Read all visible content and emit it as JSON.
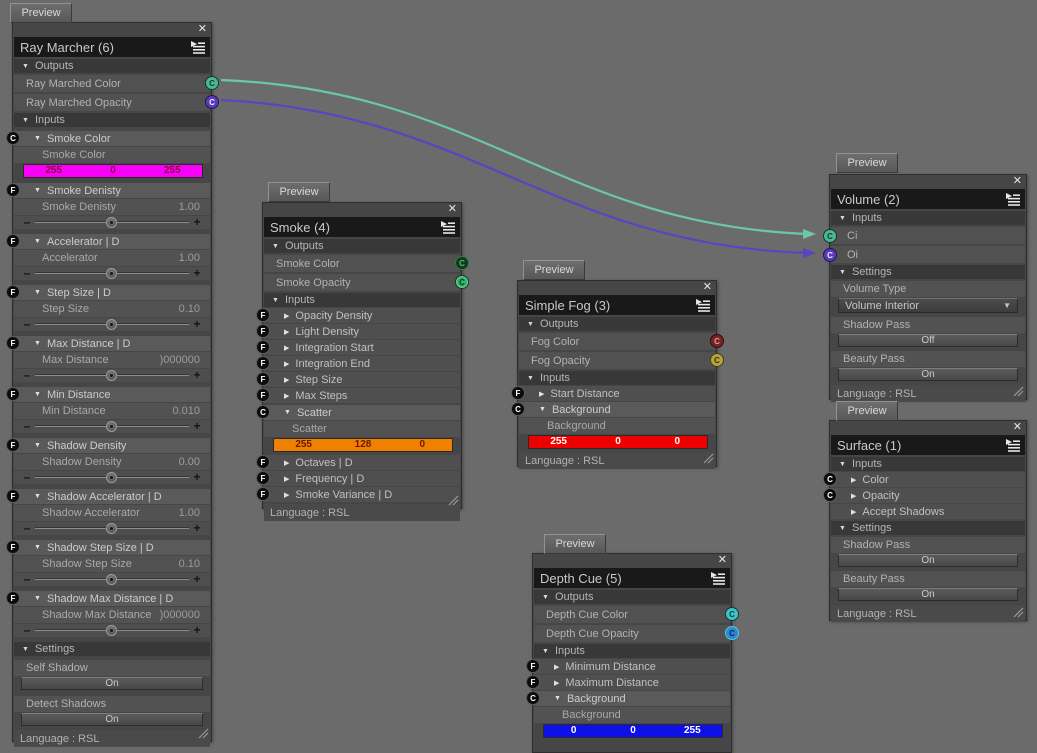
{
  "ui": {
    "preview_label": "Preview",
    "language_label": "Language : RSL"
  },
  "icons": {
    "close": "✕",
    "collapse": "▼",
    "expand": "▶",
    "minus": "–",
    "plus": "+",
    "dropdown": "▼"
  },
  "sections": {
    "outputs": "Outputs",
    "inputs": "Inputs",
    "settings": "Settings"
  },
  "colors": {
    "canvas": "#6b6b6b",
    "panel": "#464646",
    "titlebar": "#191919",
    "wire_teal": "#6cc7a7",
    "wire_purple": "#5b44c2",
    "swatch_magenta": "#f800f8",
    "swatch_orange": "#f08000",
    "swatch_red": "#ee0000",
    "swatch_blue": "#0f0fe8",
    "port_teal": "#49b893",
    "port_purple": "#5a3ab8",
    "port_green": "#33b06c",
    "port_dark_green": "#17381f",
    "port_dark_red": "#732525",
    "port_olive": "#b5a442",
    "port_cyan": "#3ec4c4",
    "port_blue": "#2f86d6"
  },
  "wires": [
    {
      "name": "ci-connection",
      "from": "Ray Marched Color",
      "to": "Ci",
      "color": "#6cc7a7"
    },
    {
      "name": "oi-connection",
      "from": "Ray Marched Opacity",
      "to": "Oi",
      "color": "#5b44c2"
    }
  ],
  "nodes": {
    "ray_marcher": {
      "title": "Ray Marcher (6)",
      "outputs": [
        {
          "label": "Ray Marched Color",
          "port": "C"
        },
        {
          "label": "Ray Marched Opacity",
          "port": "C"
        }
      ],
      "groups": [
        {
          "port": "C",
          "label": "Smoke Color",
          "sub": "Smoke Color",
          "swatch": {
            "r": "255",
            "g": "0",
            "b": "255"
          }
        },
        {
          "port": "F",
          "label": "Smoke Denisty",
          "sub": "Smoke Denisty",
          "value": "1.00"
        },
        {
          "port": "F",
          "label": "Accelerator  | D",
          "sub": "Accelerator",
          "value": "1.00"
        },
        {
          "port": "F",
          "label": "Step Size  | D",
          "sub": "Step Size",
          "value": "0.10"
        },
        {
          "port": "F",
          "label": "Max Distance  | D",
          "sub": "Max Distance",
          "value": ")000000"
        },
        {
          "port": "F",
          "label": "Min Distance",
          "sub": "Min Distance",
          "value": "0.010"
        },
        {
          "port": "F",
          "label": "Shadow Density",
          "sub": "Shadow Density",
          "value": "0.00"
        },
        {
          "port": "F",
          "label": "Shadow Accelerator  | D",
          "sub": "Shadow Accelerator",
          "value": "1.00"
        },
        {
          "port": "F",
          "label": "Shadow Step Size  | D",
          "sub": "Shadow Step Size",
          "value": "0.10"
        },
        {
          "port": "F",
          "label": "Shadow Max Distance  | D",
          "sub": "Shadow Max Distance",
          "value": ")000000"
        }
      ],
      "settings": [
        {
          "label": "Self Shadow",
          "value": "On"
        },
        {
          "label": "Detect Shadows",
          "value": "On"
        }
      ]
    },
    "smoke": {
      "title": "Smoke (4)",
      "outputs": [
        {
          "label": "Smoke Color",
          "port": "C"
        },
        {
          "label": "Smoke Opacity",
          "port": "C"
        }
      ],
      "inputs": [
        {
          "port": "F",
          "label": "Opacity Density"
        },
        {
          "port": "F",
          "label": "Light Density"
        },
        {
          "port": "F",
          "label": "Integration Start"
        },
        {
          "port": "F",
          "label": "Integration End"
        },
        {
          "port": "F",
          "label": "Step Size"
        },
        {
          "port": "F",
          "label": "Max Steps"
        }
      ],
      "scatter": {
        "port": "C",
        "label": "Scatter",
        "sub": "Scatter",
        "swatch": {
          "r": "255",
          "g": "128",
          "b": "0"
        }
      },
      "inputs2": [
        {
          "port": "F",
          "label": "Octaves  | D"
        },
        {
          "port": "F",
          "label": "Frequency  | D"
        },
        {
          "port": "F",
          "label": "Smoke Variance  | D"
        }
      ]
    },
    "simple_fog": {
      "title": "Simple Fog (3)",
      "outputs": [
        {
          "label": "Fog Color",
          "port": "C"
        },
        {
          "label": "Fog Opacity",
          "port": "C"
        }
      ],
      "inputs": [
        {
          "port": "F",
          "label": "Start Distance"
        }
      ],
      "background": {
        "port": "C",
        "label": "Background",
        "sub": "Background",
        "swatch": {
          "r": "255",
          "g": "0",
          "b": "0"
        }
      }
    },
    "volume": {
      "title": "Volume (2)",
      "inputs": [
        {
          "label": "Ci",
          "port": "C"
        },
        {
          "label": "Oi",
          "port": "C"
        }
      ],
      "settings": {
        "volume_type_label": "Volume Type",
        "volume_type_value": "Volume Interior",
        "shadow_pass_label": "Shadow Pass",
        "shadow_pass_value": "Off",
        "beauty_pass_label": "Beauty Pass",
        "beauty_pass_value": "On"
      }
    },
    "surface": {
      "title": "Surface (1)",
      "inputs": [
        {
          "port": "C",
          "label": "Color"
        },
        {
          "port": "C",
          "label": "Opacity"
        },
        {
          "port": "",
          "label": "Accept Shadows"
        }
      ],
      "settings": {
        "shadow_pass_label": "Shadow Pass",
        "shadow_pass_value": "On",
        "beauty_pass_label": "Beauty Pass",
        "beauty_pass_value": "On"
      }
    },
    "depth_cue": {
      "title": "Depth Cue (5)",
      "outputs": [
        {
          "label": "Depth Cue Color",
          "port": "C"
        },
        {
          "label": "Depth Cue Opacity",
          "port": "C"
        }
      ],
      "inputs": [
        {
          "port": "F",
          "label": "Minimum Distance"
        },
        {
          "port": "F",
          "label": "Maximum Distance"
        }
      ],
      "background": {
        "port": "C",
        "label": "Background",
        "sub": "Background",
        "swatch": {
          "r": "0",
          "g": "0",
          "b": "255"
        }
      }
    }
  }
}
